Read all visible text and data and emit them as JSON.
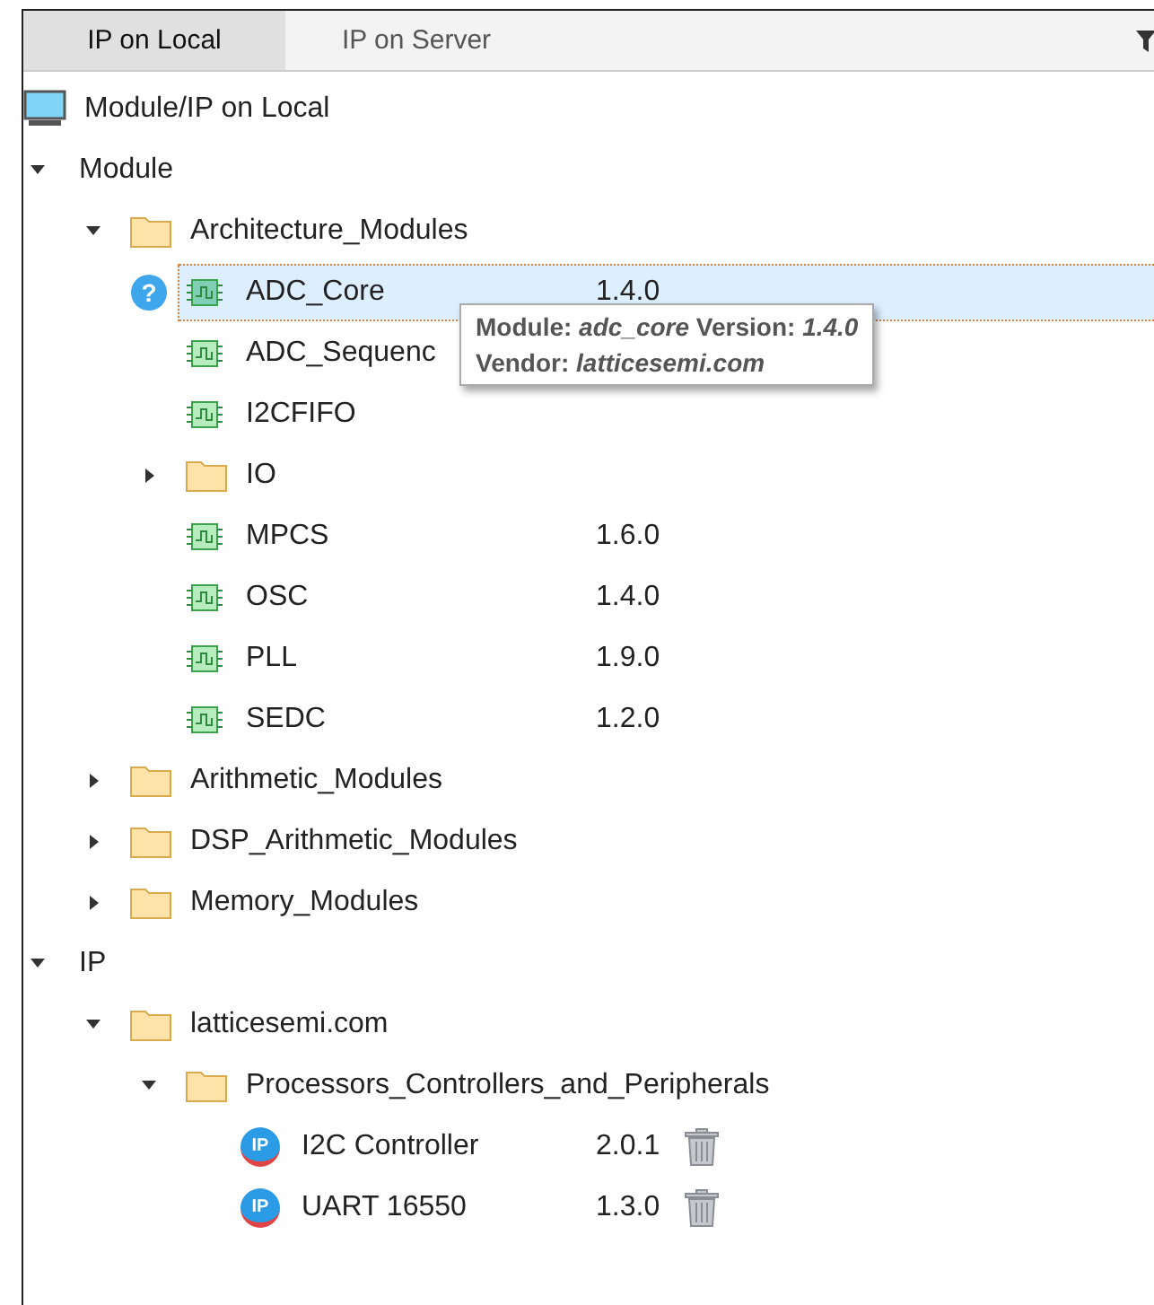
{
  "tabs": [
    {
      "label": "IP on Local",
      "selected": true
    },
    {
      "label": "IP on Server",
      "selected": false
    }
  ],
  "tree": [
    {
      "kind": "root",
      "label": "Module/IP on Local"
    },
    {
      "kind": "group",
      "label": "Module",
      "expanded": true,
      "children": [
        {
          "kind": "folder",
          "label": "Architecture_Modules",
          "expanded": true,
          "children": [
            {
              "kind": "module",
              "label": "ADC_Core",
              "version": "1.4.0",
              "selected": true,
              "help_mark": "?"
            },
            {
              "kind": "module",
              "label": "ADC_Sequenc",
              "selected": false
            },
            {
              "kind": "module",
              "label": "I2CFIFO",
              "selected": false
            },
            {
              "kind": "folder",
              "label": "IO",
              "expanded": false
            },
            {
              "kind": "module",
              "label": "MPCS",
              "version": "1.6.0",
              "selected": false
            },
            {
              "kind": "module",
              "label": "OSC",
              "version": "1.4.0",
              "selected": false
            },
            {
              "kind": "module",
              "label": "PLL",
              "version": "1.9.0",
              "selected": false
            },
            {
              "kind": "module",
              "label": "SEDC",
              "version": "1.2.0",
              "selected": false
            }
          ]
        },
        {
          "kind": "folder",
          "label": "Arithmetic_Modules",
          "expanded": false
        },
        {
          "kind": "folder",
          "label": "DSP_Arithmetic_Modules",
          "expanded": false
        },
        {
          "kind": "folder",
          "label": "Memory_Modules",
          "expanded": false
        }
      ]
    },
    {
      "kind": "group",
      "label": "IP",
      "expanded": true,
      "children": [
        {
          "kind": "folder",
          "label": "latticesemi.com",
          "expanded": true,
          "children": [
            {
              "kind": "folder",
              "label": "Processors_Controllers_and_Peripherals",
              "expanded": true,
              "children": [
                {
                  "kind": "ip",
                  "label": "I2C Controller",
                  "version": "2.0.1",
                  "badge": "IP",
                  "selected": false
                },
                {
                  "kind": "ip",
                  "label": "UART 16550",
                  "version": "1.3.0",
                  "badge": "IP",
                  "selected": false
                }
              ]
            }
          ]
        }
      ]
    }
  ],
  "tooltip": {
    "line_1": "Module: *adc_core* Version: *1.4.0*",
    "line_2": "Vendor: *latticesemi.com*"
  }
}
